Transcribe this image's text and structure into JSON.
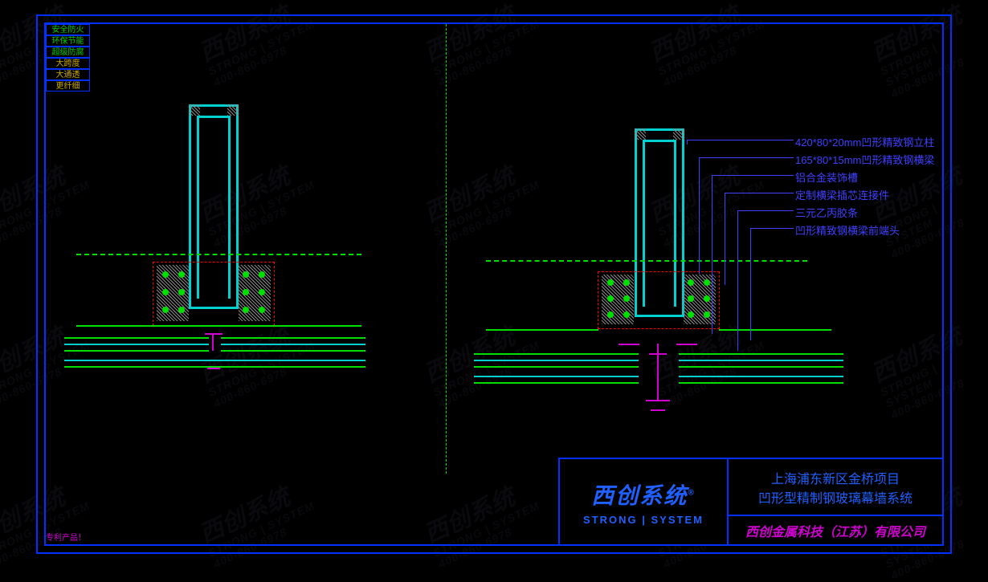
{
  "watermark": {
    "line1": "西创系统",
    "line2": "STRONG | SYSTEM",
    "line3": "400-860-6978"
  },
  "badges": {
    "b1": "安全防火",
    "b2": "环保节能",
    "b3": "超级防腐",
    "b4": "大跨度",
    "b5": "大通透",
    "b6": "更纤细"
  },
  "patent_note": "专利产品！",
  "annotations": {
    "a1": "420*80*20mm凹形精致钢立柱",
    "a2": "165*80*15mm凹形精致钢横梁",
    "a3": "铝合金装饰槽",
    "a4": "定制横梁插芯连接件",
    "a5": "三元乙丙胶条",
    "a6": "凹形精致钢横梁前端头"
  },
  "title_block": {
    "logo_text": "西创系统",
    "logo_sup": "®",
    "logo_sub": "STRONG | SYSTEM",
    "project_line1": "上海浦东新区金桥项目",
    "project_line2": "凹形型精制钢玻璃幕墙系统",
    "company": "西创金属科技（江苏）有限公司"
  },
  "colors": {
    "frame": "#0030ff",
    "steel": "#00d0d0",
    "green": "#00e000",
    "magenta": "#d000d0",
    "red": "#ff0000"
  }
}
